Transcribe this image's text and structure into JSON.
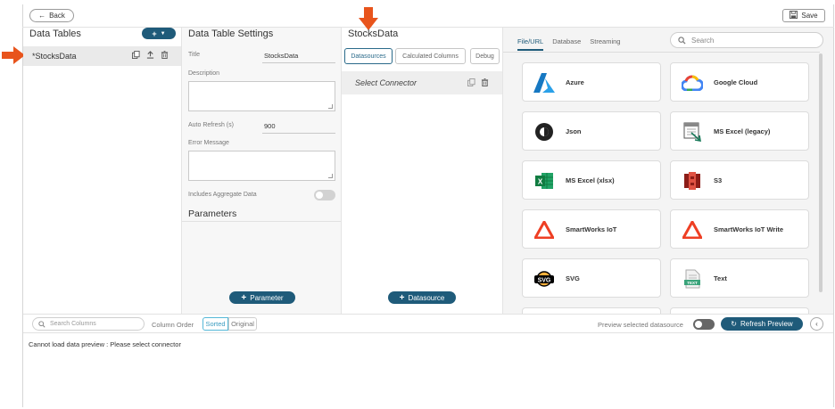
{
  "topbar": {
    "back_label": "Back",
    "save_label": "Save"
  },
  "data_tables": {
    "title": "Data Tables",
    "add_label": "+",
    "items": [
      {
        "label": "*StocksData"
      }
    ]
  },
  "settings": {
    "title": "Data Table Settings",
    "title_label": "Title",
    "title_value": "StocksData",
    "description_label": "Description",
    "auto_refresh_label": "Auto Refresh (s)",
    "auto_refresh_value": "900",
    "error_message_label": "Error Message",
    "aggregate_label": "Includes Aggregate Data",
    "parameters_title": "Parameters",
    "add_parameter_label": "Parameter"
  },
  "datasource": {
    "title": "StocksData",
    "tabs": [
      "Datasources",
      "Calculated Columns",
      "Debug"
    ],
    "connector_label": "Select Connector",
    "add_datasource_label": "Datasource"
  },
  "connectors": {
    "tabs": [
      "File/URL",
      "Database",
      "Streaming"
    ],
    "search_placeholder": "Search",
    "cards": [
      {
        "name": "Azure",
        "icon": "azure-icon"
      },
      {
        "name": "Google Cloud",
        "icon": "google-cloud-icon"
      },
      {
        "name": "Json",
        "icon": "json-icon"
      },
      {
        "name": "MS Excel (legacy)",
        "icon": "excel-legacy-icon"
      },
      {
        "name": "MS Excel (xlsx)",
        "icon": "excel-icon"
      },
      {
        "name": "S3",
        "icon": "s3-icon"
      },
      {
        "name": "SmartWorks IoT",
        "icon": "smartworks-icon"
      },
      {
        "name": "SmartWorks IoT Write",
        "icon": "smartworks-icon"
      },
      {
        "name": "SVG",
        "icon": "svg-icon"
      },
      {
        "name": "Text",
        "icon": "text-file-icon"
      }
    ]
  },
  "preview": {
    "search_placeholder": "Search Columns",
    "column_order_label": "Column Order",
    "sorted_label": "Sorted",
    "original_label": "Original",
    "preview_label": "Preview selected datasource",
    "refresh_label": "Refresh Preview",
    "message": "Cannot load data preview : Please select connector"
  },
  "colors": {
    "accent": "#1f5b7a",
    "arrow": "#e8541c"
  }
}
